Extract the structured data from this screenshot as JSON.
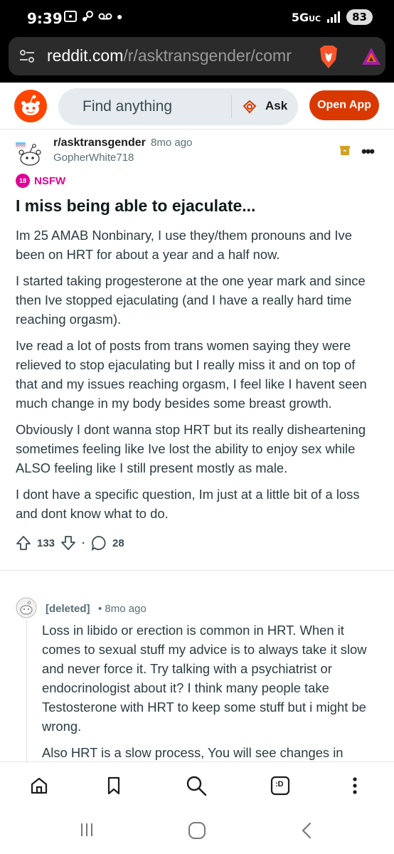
{
  "status_bar": {
    "time": "9:39",
    "network": "5G",
    "network_sub": "UC",
    "battery": "83"
  },
  "browser": {
    "url_domain": "reddit.com",
    "url_path": "/r/asktransgender/comr"
  },
  "header": {
    "search_placeholder": "Find anything",
    "ask_label": "Ask",
    "open_app_label": "Open App"
  },
  "post": {
    "subreddit": "r/asktransgender",
    "time": "8mo ago",
    "author": "GopherWhite718",
    "nsfw_badge": "18",
    "nsfw_label": "NSFW",
    "title": "I miss being able to ejaculate...",
    "body": [
      "Im 25 AMAB Nonbinary, I use they/them pronouns and Ive been on HRT for about a year and a half now.",
      "I started taking progesterone at the one year mark and since then Ive stopped ejaculating (and I have a really hard time reaching orgasm).",
      "Ive read a lot of posts from trans women saying they were relieved to stop ejaculating but I really miss it and on top of that and my issues reaching orgasm, I feel like I havent seen much change in my body besides some breast growth.",
      "Obviously I dont wanna stop HRT but its really disheartening sometimes feeling like Ive lost the ability to enjoy sex while ALSO feeling like I still present mostly as male.",
      "I dont have a specific question, Im just at a little bit of a loss and dont know what to do."
    ],
    "upvotes": "133",
    "comments": "28"
  },
  "comment": {
    "author": "[deleted]",
    "time": "• 8mo ago",
    "body": [
      "Loss in libido or erection is common in HRT. When it comes to sexual stuff my advice is to always take it slow and never force it. Try talking with a psychiatrist or endocrinologist about it? I think many people take Testosterone with HRT to keep some stuff but i might be wrong.",
      "Also HRT is a slow process, You will see changes in"
    ]
  },
  "bottom_nav": {
    "icons": [
      "home-icon",
      "bookmark-icon",
      "search-icon",
      "tabs-icon",
      "more-icon"
    ],
    "tabs_label": ":D"
  },
  "colors": {
    "reddit_orange": "#ff4500",
    "open_app": "#d93900",
    "nsfw": "#e00096"
  }
}
